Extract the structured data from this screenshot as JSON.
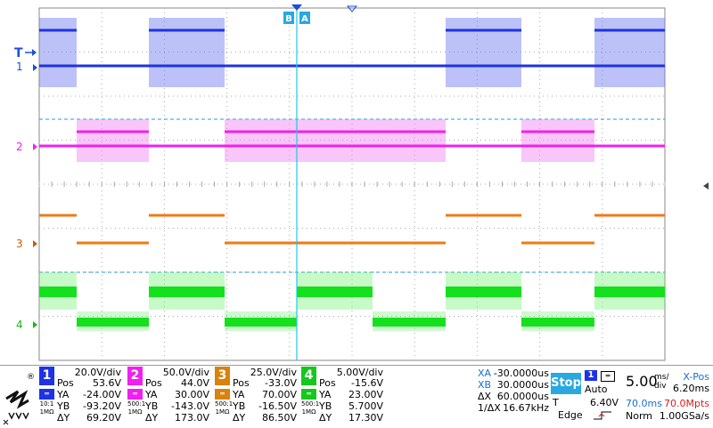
{
  "colors": {
    "ch1": "#1e32e6",
    "ch2": "#f020f0",
    "ch3": "#f07a14",
    "ch4": "#14e01e",
    "cursor": "#1ec8e6",
    "trigger_line": "#2a9ad8"
  },
  "markers": {
    "trigger": "T",
    "cursor_b": "B",
    "cursor_a": "A",
    "ch1": "1",
    "ch2": "2",
    "ch3": "3",
    "ch4": "4"
  },
  "channels": [
    {
      "num": "1",
      "vdiv": "20.0V/div",
      "pos": "53.6V",
      "ya": "-24.00V",
      "yb": "-93.20V",
      "dy": "69.20V",
      "color": "#1e32e6"
    },
    {
      "num": "2",
      "vdiv": "50.0V/div",
      "pos": "44.0V",
      "ya": "30.00V",
      "yb": "-143.0V",
      "dy": "173.0V",
      "color": "#f020f0"
    },
    {
      "num": "3",
      "vdiv": "25.0V/div",
      "pos": "-33.0V",
      "ya": "70.00V",
      "yb": "-16.50V",
      "dy": "86.50V",
      "color": "#d8820f"
    },
    {
      "num": "4",
      "vdiv": "5.00V/div",
      "pos": "-15.6V",
      "ya": "23.00V",
      "yb": "5.700V",
      "dy": "17.30V",
      "color": "#14c81e"
    }
  ],
  "labels": {
    "pos": "Pos",
    "ya": "YA",
    "yb": "YB",
    "dy": "ΔY"
  },
  "coupling": {
    "ch1": "10:1",
    "ch1b": "1MΩ",
    "ch2": "500:1",
    "ch2b": "1MΩ",
    "ch3": "500:1",
    "ch3b": "1MΩ",
    "ch4": "500:1",
    "ch4b": "1MΩ"
  },
  "cursors": {
    "xa_label": "XA",
    "xa": "-30.0000us",
    "xb_label": "XB",
    "xb": "30.0000us",
    "dx_label": "ΔX",
    "dx": "60.0000us",
    "freq_label": "1/ΔX",
    "freq": "16.67kHz"
  },
  "trigger": {
    "state": "Stop",
    "source": "1",
    "mode": "Auto",
    "level_label": "T",
    "level": "6.40V",
    "type": "Edge"
  },
  "timebase": {
    "value": "5.00",
    "unit_top": "ms/",
    "unit_bot": "div",
    "xpos_label": "X-Pos",
    "xpos": "6.20ms",
    "mem_time": "70.0ms",
    "mem_pts": "70.0Mpts",
    "mode": "Norm",
    "rate": "1.00GSa/s"
  }
}
